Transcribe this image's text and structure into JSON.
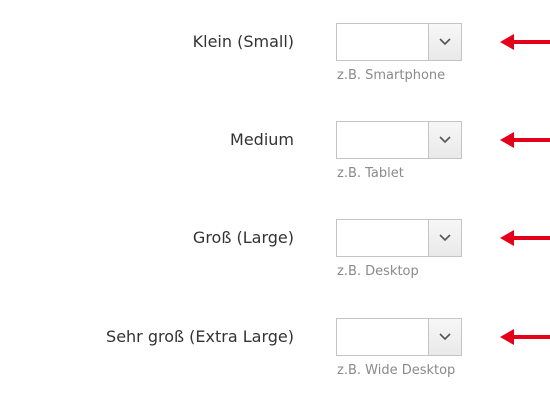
{
  "colors": {
    "arrow": "#e4001b",
    "label": "#333333",
    "hint": "#8a8a8a",
    "border": "#c4c4c4"
  },
  "rows": [
    {
      "label": "Klein (Small)",
      "value": "",
      "hint": "z.B. Smartphone"
    },
    {
      "label": "Medium",
      "value": "",
      "hint": "z.B. Tablet"
    },
    {
      "label": "Groß (Large)",
      "value": "",
      "hint": "z.B. Desktop"
    },
    {
      "label": "Sehr groß (Extra Large)",
      "value": "",
      "hint": "z.B. Wide Desktop"
    }
  ],
  "icons": {
    "dropdown": "chevron-down-icon",
    "pointer": "red-arrow-icon"
  }
}
